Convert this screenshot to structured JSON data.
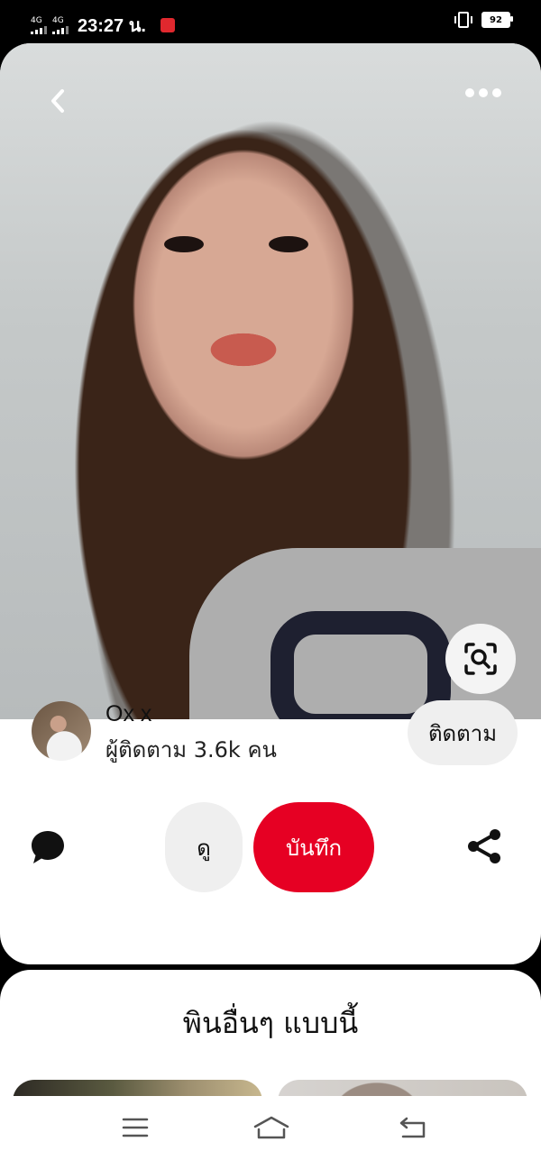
{
  "status_bar": {
    "network_1": "4G",
    "network_2": "4G",
    "time": "23:27 น.",
    "battery": "92"
  },
  "pin": {
    "nav": {
      "back_icon": "chevron-left-icon",
      "more_icon": "more-dots-icon"
    },
    "visual_search_icon": "lens-search-icon"
  },
  "creator": {
    "name": "Ox x",
    "followers": "ผู้ติดตาม 3.6k คน",
    "follow_label": "ติดตาม"
  },
  "actions": {
    "comment_icon": "comment-bubble-icon",
    "view_label": "ดู",
    "save_label": "บันทึก",
    "share_icon": "share-icon"
  },
  "more_like_this": {
    "title": "พินอื่นๆ แบบนี้"
  },
  "system_nav": {
    "menu_icon": "menu-icon",
    "home_icon": "home-icon",
    "back_icon": "back-icon"
  },
  "colors": {
    "save_red": "#e60023",
    "chip_gray": "#efefef"
  }
}
